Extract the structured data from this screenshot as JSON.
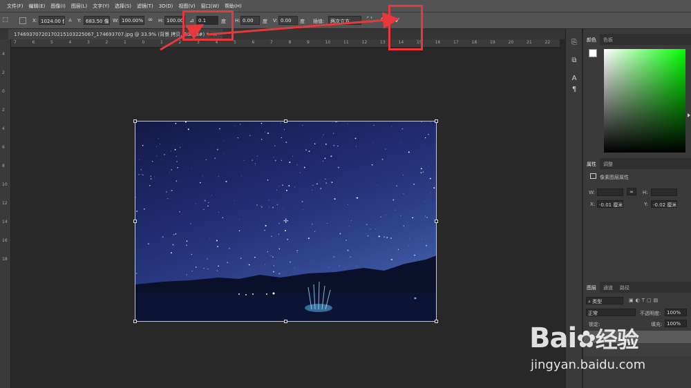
{
  "menu": [
    "文件(F)",
    "编辑(E)",
    "图像(I)",
    "图层(L)",
    "文字(Y)",
    "选择(S)",
    "滤镜(T)",
    "3D(D)",
    "视图(V)",
    "窗口(W)",
    "帮助(H)"
  ],
  "options": {
    "x_label": "X:",
    "x_value": "1024.00 像",
    "y_label": "Y:",
    "y_value": "683.50 像",
    "w_label": "W:",
    "w_value": "100.00%",
    "h_label": "H:",
    "h_value": "100.00%",
    "angle_value": "0.1",
    "angle_unit": "度",
    "hskew_label": "H:",
    "hskew_value": "0.00",
    "hskew_unit": "度",
    "vskew_label": "V:",
    "vskew_value": "0.00",
    "vskew_unit": "度",
    "interp_label": "插值:",
    "interp_value": "两次立方",
    "commit_icon": "check-icon",
    "cancel_icon": "cancel-icon",
    "warp_icon": "warp-icon"
  },
  "document_tab": {
    "title": "174693707201702151032250​67_174693707.jpg @ 33.9% (背景 拷贝, RGB/8#) *",
    "close": "×"
  },
  "ruler_top": [
    "7",
    "6",
    "5",
    "4",
    "3",
    "2",
    "1",
    "0",
    "1",
    "2",
    "3",
    "4",
    "5",
    "6",
    "7",
    "8",
    "9",
    "10",
    "11",
    "12",
    "13",
    "14",
    "15",
    "16",
    "17",
    "18",
    "19",
    "20",
    "21",
    "22"
  ],
  "ruler_left": [
    "4",
    "2",
    "0",
    "2",
    "4",
    "6",
    "8",
    "10",
    "12",
    "14",
    "16",
    "18"
  ],
  "color_panel": {
    "tabs": [
      "颜色",
      "色板"
    ],
    "active": 0
  },
  "properties_panel": {
    "tabs": [
      "属性",
      "调整"
    ],
    "active": 0,
    "layer_type": "像素图层属性",
    "w_label": "W:",
    "h_label": "H:",
    "x_label": "X:",
    "x_value": "-0.01 厘米",
    "y_label": "Y:",
    "y_value": "-0.02 厘米"
  },
  "layers_panel": {
    "tabs": [
      "图层",
      "通道",
      "路径"
    ],
    "active": 0,
    "filter_kind": "类型",
    "blend_mode": "正常",
    "opacity_label": "不透明度:",
    "opacity_value": "100%",
    "fill_label": "填充:",
    "fill_value": "100%",
    "lock_label": "锁定:"
  },
  "watermark": {
    "brand": "Bai",
    "brand2": "经验",
    "url": "jingyan.baidu.com"
  },
  "colors": {
    "annotation_red": "#e8383d",
    "foreground": "#ffffff",
    "background": "#000000"
  }
}
